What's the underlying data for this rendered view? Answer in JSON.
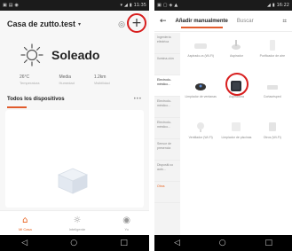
{
  "left_phone": {
    "status_time": "11:35",
    "header": {
      "title": "Casa de zutto.test"
    },
    "weather": {
      "label": "Soleado",
      "stats": [
        {
          "value": "26°C",
          "key": "Temperatura"
        },
        {
          "value": "Media",
          "key": "Humedad"
        },
        {
          "value": "1.2km",
          "key": "Visibilidad"
        }
      ]
    },
    "devices_section": {
      "label": "Todos los dispositivos"
    },
    "tabs": [
      {
        "label": "Mi Casa",
        "icon": "home-icon"
      },
      {
        "label": "Inteligente",
        "icon": "sun-small-icon"
      },
      {
        "label": "Yo",
        "icon": "user-icon"
      }
    ]
  },
  "right_phone": {
    "status_time": "16:22",
    "header": {
      "tab_manual": "Añadir manualmente",
      "tab_search": "Buscar"
    },
    "categories": [
      {
        "label": "Ingeniería eléctrica"
      },
      {
        "label": "Ilumina-ción"
      },
      {
        "label": "Electrodo-méstico..."
      },
      {
        "label": "Electrodo-méstico..."
      },
      {
        "label": "Electrodo-méstico..."
      },
      {
        "label": "Sensor de presencia"
      },
      {
        "label": "Dispositi-vo autó..."
      },
      {
        "label": "Otros"
      }
    ],
    "devices": [
      {
        "name": "Aspirado-ra (Wi-Fi)"
      },
      {
        "name": "Aspirador"
      },
      {
        "name": "Purificador de aire"
      },
      {
        "name": "Limpiador de ventanas"
      },
      {
        "name": "Aspiradora"
      },
      {
        "name": "Cortacésped"
      },
      {
        "name": "Ventilador (Wi-Fi)"
      },
      {
        "name": "Limpiador de piscinas"
      },
      {
        "name": "Otros (Wi-Fi)"
      }
    ]
  },
  "colors": {
    "accent": "#e8621e",
    "highlight_circle": "#d81e1e"
  }
}
